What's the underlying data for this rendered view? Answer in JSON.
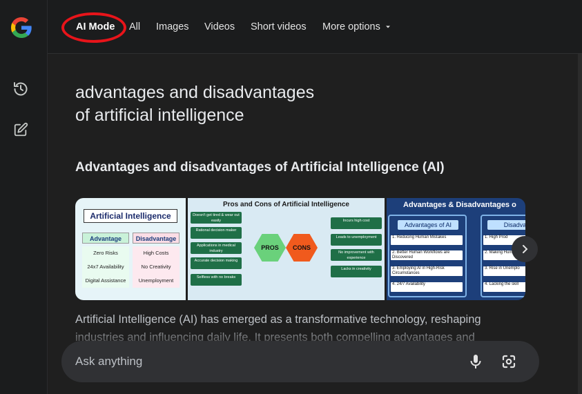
{
  "sidebar": {
    "logo_icon": "google-g-logo",
    "items": [
      {
        "icon": "history-icon"
      },
      {
        "icon": "new-chat-edit-icon"
      }
    ]
  },
  "tabs": [
    {
      "label": "AI Mode",
      "active": true
    },
    {
      "label": "All"
    },
    {
      "label": "Images"
    },
    {
      "label": "Videos"
    },
    {
      "label": "Short videos"
    },
    {
      "label": "More options",
      "icon": "caret-down-icon"
    }
  ],
  "highlight_color": "#e8141a",
  "query": {
    "line1": "advantages and disadvantages",
    "line2": "of artificial intelligence"
  },
  "result": {
    "heading": "Advantages and disadvantages of Artificial Intelligence (AI)",
    "body": "Artificial Intelligence (AI) has emerged as a transformative technology, reshaping industries and influencing daily life. It presents both compelling advantages and"
  },
  "images": [
    {
      "title": "Artificial Intelligence",
      "advantage_head": "Advantage",
      "disadvantage_head": "Disadvantage",
      "advantages": [
        "Zero Risks",
        "24x7 Availability",
        "Digital Assistance"
      ],
      "disadvantages": [
        "High Costs",
        "No Creativity",
        "Unemployment"
      ]
    },
    {
      "title": "Pros and Cons of Artificial Intelligence",
      "pros_label": "PROS",
      "cons_label": "CONS",
      "pros": [
        "Doesn't get tired & wear out easily",
        "Rational decision maker",
        "Applications in medical industry",
        "Accurate decision making",
        "Selfless with no breaks"
      ],
      "cons": [
        "Incurs high cost",
        "Leads to unemployment",
        "No improvement with experience",
        "Lacks in creativity"
      ]
    },
    {
      "title": "Advantages & Disadvantages o",
      "left_head": "Advantages of AI",
      "right_head": "Disadva",
      "left_items": [
        "1. Reducing Human Mistakes",
        "2. Better Human Workflows are Discovered",
        "3. Employing AI in High-Risk Circumstances",
        "4. 24/7 Availability"
      ],
      "right_items": [
        "1. High Prod",
        "2. Making Huma",
        "3. Rise in Unemplo",
        "4. Lacking the skill"
      ]
    }
  ],
  "carousel_next_icon": "chevron-right-icon",
  "ask": {
    "placeholder": "Ask anything",
    "mic_icon": "microphone-icon",
    "lens_icon": "google-lens-icon"
  }
}
